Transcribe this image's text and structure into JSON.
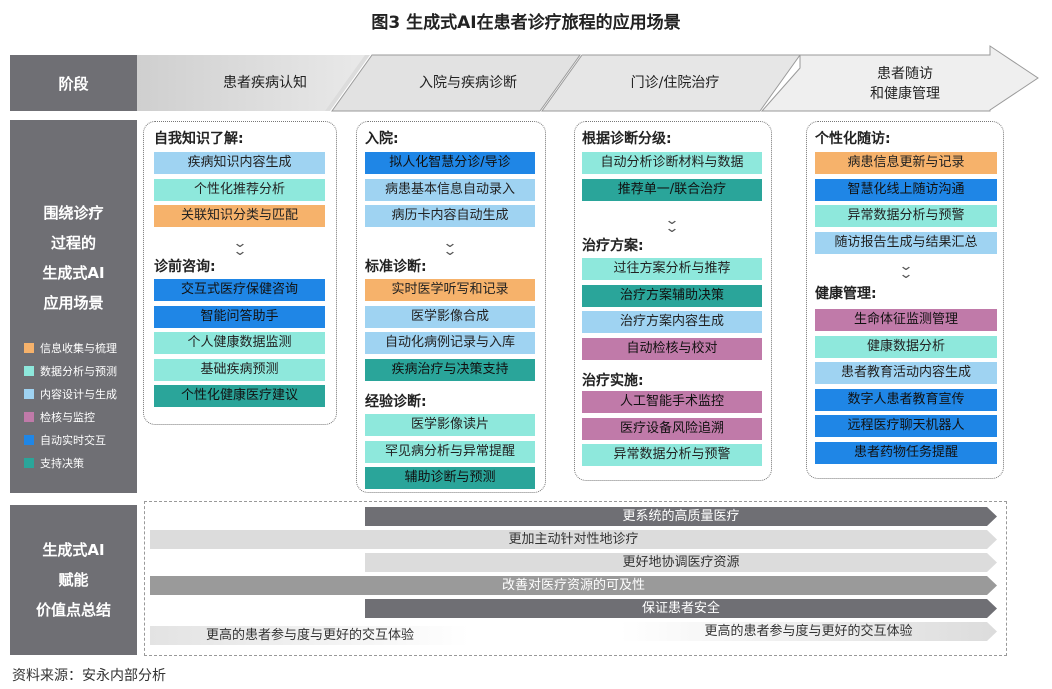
{
  "title": "图3  生成式AI在患者诊疗旅程的应用场景",
  "side": {
    "stage": "阶段",
    "app": [
      "围绕诊疗",
      "过程的",
      "生成式AI",
      "应用场景"
    ],
    "value": [
      "生成式AI",
      "赋能",
      "价值点总结"
    ]
  },
  "colors": {
    "orange": "#f6b26b",
    "lightblue": "#9fd3f2",
    "teal_light": "#8ee8dc",
    "mauve": "#c07aa9",
    "blue": "#1f86e6",
    "teal": "#2aa59a",
    "side_gray": "#6f6f74",
    "bar_dark": "#6f6f74",
    "bar_mid": "#9a9a9a",
    "bar_light": "#dcdcdc"
  },
  "legend": [
    {
      "label": "信息收集与梳理",
      "color": "#f6b26b"
    },
    {
      "label": "数据分析与预测",
      "color": "#8ee8dc"
    },
    {
      "label": "内容设计与生成",
      "color": "#9fd3f2"
    },
    {
      "label": "检核与监控",
      "color": "#c07aa9"
    },
    {
      "label": "自动实时交互",
      "color": "#1f86e6"
    },
    {
      "label": "支持决策",
      "color": "#2aa59a"
    }
  ],
  "stages": [
    "患者疾病认知",
    "入院与疾病诊断",
    "门诊/住院治疗",
    "患者随访",
    "和健康管理"
  ],
  "columns": [
    {
      "sections": [
        {
          "title": "自我知识了解:",
          "items": [
            {
              "label": "疾病知识内容生成",
              "color": "#9fd3f2"
            },
            {
              "label": "个性化推荐分析",
              "color": "#8ee8dc"
            },
            {
              "label": "关联知识分类与匹配",
              "color": "#f6b26b"
            }
          ]
        },
        {
          "title": "诊前咨询:",
          "items": [
            {
              "label": "交互式医疗保健咨询",
              "color": "#1f86e6"
            },
            {
              "label": "智能问答助手",
              "color": "#1f86e6"
            },
            {
              "label": "个人健康数据监测",
              "color": "#8ee8dc"
            },
            {
              "label": "基础疾病预测",
              "color": "#8ee8dc"
            },
            {
              "label": "个性化健康医疗建议",
              "color": "#2aa59a"
            }
          ]
        }
      ]
    },
    {
      "sections": [
        {
          "title": "入院:",
          "items": [
            {
              "label": "拟人化智慧分诊/导诊",
              "color": "#1f86e6"
            },
            {
              "label": "病患基本信息自动录入",
              "color": "#9fd3f2"
            },
            {
              "label": "病历卡内容自动生成",
              "color": "#9fd3f2"
            }
          ]
        },
        {
          "title": "标准诊断:",
          "items": [
            {
              "label": "实时医学听写和记录",
              "color": "#f6b26b"
            },
            {
              "label": "医学影像合成",
              "color": "#9fd3f2"
            },
            {
              "label": "自动化病例记录与入库",
              "color": "#9fd3f2"
            },
            {
              "label": "疾病治疗与决策支持",
              "color": "#2aa59a"
            }
          ]
        },
        {
          "title": "经验诊断:",
          "items": [
            {
              "label": "医学影像读片",
              "color": "#8ee8dc"
            },
            {
              "label": "罕见病分析与异常提醒",
              "color": "#8ee8dc"
            },
            {
              "label": "辅助诊断与预测",
              "color": "#2aa59a"
            }
          ]
        }
      ]
    },
    {
      "sections": [
        {
          "title": "根据诊断分级:",
          "items": [
            {
              "label": "自动分析诊断材料与数据",
              "color": "#8ee8dc"
            },
            {
              "label": "推荐单一/联合治疗",
              "color": "#2aa59a"
            }
          ]
        },
        {
          "title": "治疗方案:",
          "items": [
            {
              "label": "过往方案分析与推荐",
              "color": "#8ee8dc"
            },
            {
              "label": "治疗方案辅助决策",
              "color": "#2aa59a"
            },
            {
              "label": "治疗方案内容生成",
              "color": "#9fd3f2"
            },
            {
              "label": "自动检核与校对",
              "color": "#c07aa9"
            }
          ]
        },
        {
          "title": "治疗实施:",
          "items": [
            {
              "label": "人工智能手术监控",
              "color": "#c07aa9"
            },
            {
              "label": "医疗设备风险追溯",
              "color": "#c07aa9"
            },
            {
              "label": "异常数据分析与预警",
              "color": "#8ee8dc"
            }
          ]
        }
      ]
    },
    {
      "sections": [
        {
          "title": "个性化随访:",
          "items": [
            {
              "label": "病患信息更新与记录",
              "color": "#f6b26b"
            },
            {
              "label": "智慧化线上随访沟通",
              "color": "#1f86e6"
            },
            {
              "label": "异常数据分析与预警",
              "color": "#8ee8dc"
            },
            {
              "label": "随访报告生成与结果汇总",
              "color": "#9fd3f2"
            }
          ]
        },
        {
          "title": "健康管理:",
          "items": [
            {
              "label": "生命体征监测管理",
              "color": "#c07aa9"
            },
            {
              "label": "健康数据分析",
              "color": "#8ee8dc"
            },
            {
              "label": "患者教育活动内容生成",
              "color": "#9fd3f2"
            },
            {
              "label": "数字人患者教育宣传",
              "color": "#1f86e6"
            },
            {
              "label": "远程医疗聊天机器人",
              "color": "#1f86e6"
            },
            {
              "label": "患者药物任务提醒",
              "color": "#1f86e6"
            }
          ]
        }
      ]
    }
  ],
  "value_bars": [
    "更系统的高质量医疗",
    "更加主动针对性地诊疗",
    "更好地协调医疗资源",
    "改善对医疗资源的可及性",
    "保证患者安全",
    "更高的患者参与度与更好的交互体验",
    "更高的患者参与度与更好的交互体验"
  ],
  "source": "资料来源：安永内部分析"
}
